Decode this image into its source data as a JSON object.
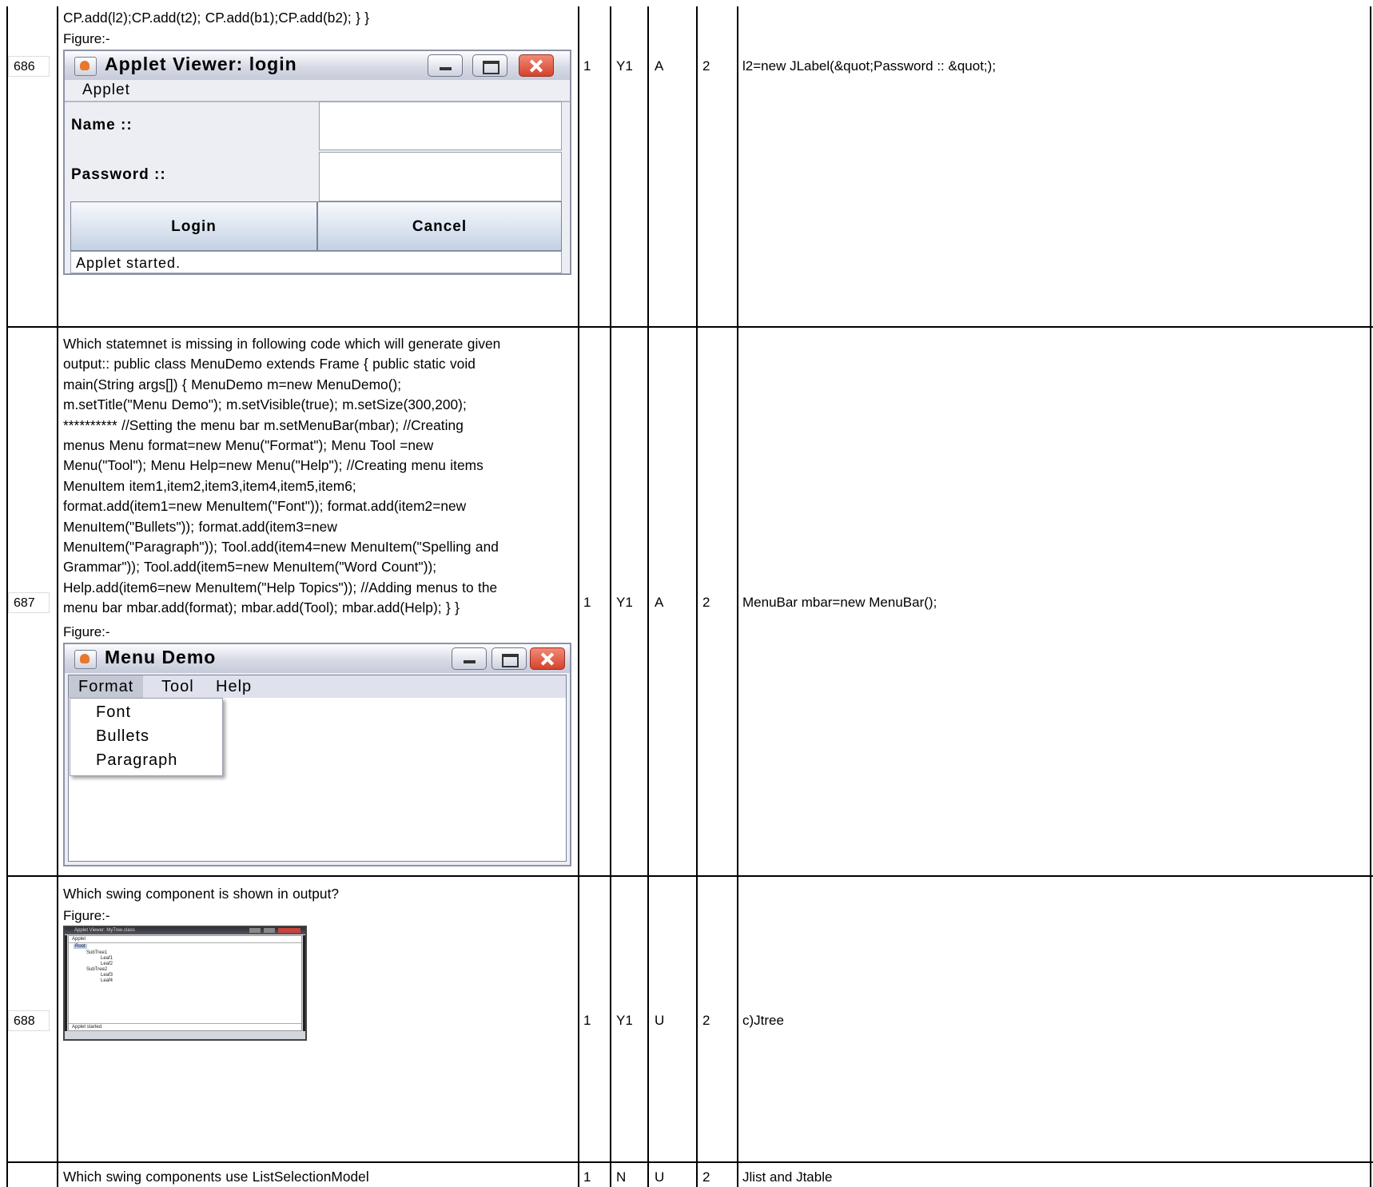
{
  "rows": [
    {
      "number": "686",
      "question_lines": [
        "CP.add(l2);CP.add(t2); CP.add(b1);CP.add(b2); } }"
      ],
      "figure_label": "Figure:-",
      "marks": "1",
      "code": "Y1",
      "level": "A",
      "co": "2",
      "answer": "l2=new JLabel(&quot;Password :: &quot;);",
      "figure": {
        "window_title": "Applet Viewer: login",
        "menu": "Applet",
        "name_label": "Name ::",
        "password_label": "Password ::",
        "login_button": "Login",
        "cancel_button": "Cancel",
        "status": "Applet started."
      }
    },
    {
      "number": "687",
      "question_lines": [
        "Which statemnet is missing in following code which will generate given",
        "output:: public class MenuDemo extends Frame { public static void",
        "main(String args[]) { MenuDemo m=new MenuDemo();",
        "m.setTitle(\"Menu Demo\"); m.setVisible(true); m.setSize(300,200);",
        "********** //Setting the menu bar m.setMenuBar(mbar); //Creating",
        "menus Menu format=new Menu(\"Format\"); Menu Tool =new",
        "Menu(\"Tool\"); Menu Help=new Menu(\"Help\"); //Creating menu items",
        "MenuItem item1,item2,item3,item4,item5,item6;",
        "format.add(item1=new MenuItem(\"Font\")); format.add(item2=new",
        "MenuItem(\"Bullets\")); format.add(item3=new",
        "MenuItem(\"Paragraph\")); Tool.add(item4=new MenuItem(\"Spelling and",
        "Grammar\")); Tool.add(item5=new MenuItem(\"Word Count\"));",
        "Help.add(item6=new MenuItem(\"Help Topics\")); //Adding menus to the",
        "menu bar mbar.add(format); mbar.add(Tool); mbar.add(Help); } }"
      ],
      "figure_label": "Figure:-",
      "marks": "1",
      "code": "Y1",
      "level": "A",
      "co": "2",
      "answer": "MenuBar mbar=new MenuBar();",
      "figure": {
        "window_title": "Menu Demo",
        "menus": [
          "Format",
          "Tool",
          "Help"
        ],
        "dropdown_items": [
          "Font",
          "Bullets",
          "Paragraph"
        ]
      }
    },
    {
      "number": "688",
      "question_lines": [
        "Which swing component is shown in output?"
      ],
      "figure_label": "Figure:-",
      "marks": "1",
      "code": "Y1",
      "level": "U",
      "co": "2",
      "answer": "c)Jtree",
      "figure": {
        "window_title": "Applet Viewer: MyTree.class",
        "menu": "Applet",
        "tree_nodes": [
          "Root",
          "SubTree1",
          "Leaf1",
          "Leaf2",
          "SubTree2",
          "Leaf3",
          "Leaf4"
        ],
        "status": "Applet started."
      }
    },
    {
      "number": "",
      "question_lines": [
        "Which swing components use ListSelectionModel"
      ],
      "marks": "1",
      "code": "N",
      "level": "U",
      "co": "2",
      "answer": "Jlist and Jtable"
    }
  ]
}
